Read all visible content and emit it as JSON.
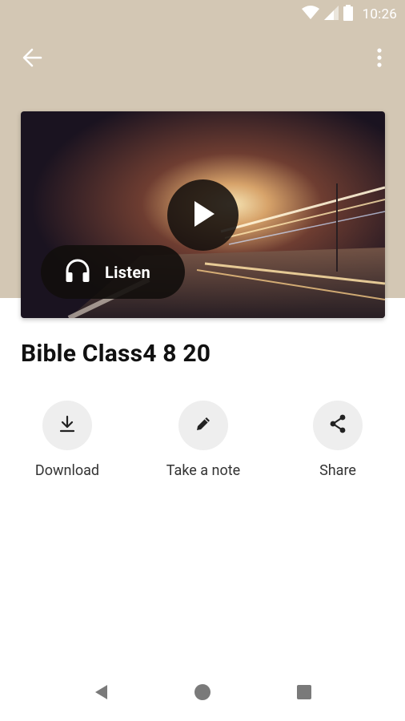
{
  "status_bar": {
    "time": "10:26"
  },
  "toolbar": {
    "back_icon": "arrow-left-icon",
    "menu_icon": "more-vertical-icon"
  },
  "media": {
    "listen_label": "Listen",
    "play_icon": "play-icon",
    "listen_icon": "headphones-icon"
  },
  "sermon": {
    "title": "Bible Class4 8 20"
  },
  "actions": [
    {
      "label": "Download",
      "icon": "download-icon"
    },
    {
      "label": "Take a note",
      "icon": "pencil-icon"
    },
    {
      "label": "Share",
      "icon": "share-icon"
    }
  ],
  "colors": {
    "header_bg": "#d3c7b4",
    "action_circle": "#eeeeee"
  }
}
